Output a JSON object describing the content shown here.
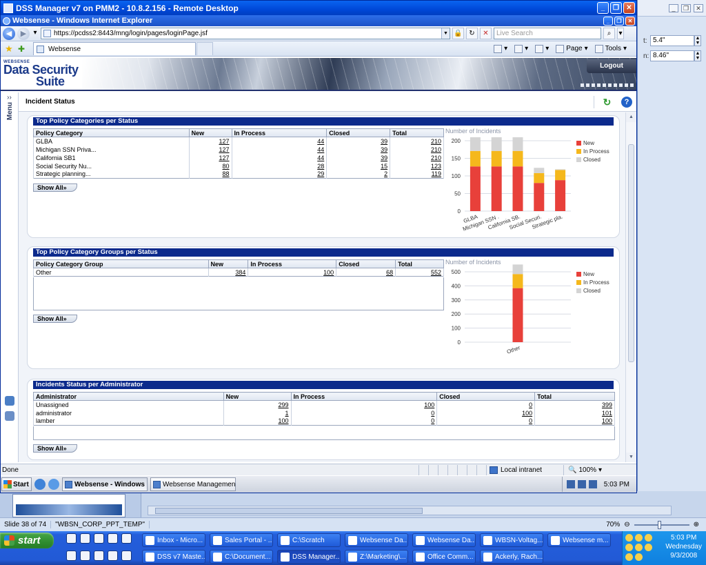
{
  "remote_desktop": {
    "title": "DSS Manager v7 on PMM2 - 10.8.2.156 - Remote Desktop"
  },
  "ie": {
    "title": "Websense - Windows Internet Explorer",
    "address": "https://pcdss2:8443/mng/login/pages/loginPage.jsf",
    "search_placeholder": "Live Search",
    "tab_label": "Websense",
    "cmd_page": "Page",
    "cmd_tools": "Tools",
    "status_done": "Done",
    "status_zone": "Local intranet",
    "status_zoom": "100%"
  },
  "websense": {
    "brand": "WEBSENSE",
    "logo_line1": "Data Security",
    "logo_line2": "Suite",
    "logout_label": "Logout",
    "menu_label": "Menu",
    "page_title": "Incident Status",
    "show_all_label": "Show All»",
    "legend": [
      "New",
      "In Process",
      "Closed"
    ],
    "chart_ylabel": "Number of Incidents"
  },
  "panel_categories": {
    "title": "Top Policy Categories per Status",
    "columns": [
      "Policy Category",
      "New",
      "In Process",
      "Closed",
      "Total"
    ],
    "rows": [
      [
        "GLBA",
        "127",
        "44",
        "39",
        "210"
      ],
      [
        "Michigan SSN Priva...",
        "127",
        "44",
        "39",
        "210"
      ],
      [
        "California SB1",
        "127",
        "44",
        "39",
        "210"
      ],
      [
        "Social Security Nu...",
        "80",
        "28",
        "15",
        "123"
      ],
      [
        "Strategic planning...",
        "88",
        "29",
        "2",
        "119"
      ]
    ]
  },
  "panel_groups": {
    "title": "Top Policy Category Groups per Status",
    "columns": [
      "Policy Category Group",
      "New",
      "In Process",
      "Closed",
      "Total"
    ],
    "rows": [
      [
        "Other",
        "384",
        "100",
        "68",
        "552"
      ]
    ]
  },
  "panel_admins": {
    "title": "Incidents Status per Administrator",
    "columns": [
      "Administrator",
      "New",
      "In Process",
      "Closed",
      "Total"
    ],
    "rows": [
      [
        "Unassigned",
        "299",
        "100",
        "0",
        "399"
      ],
      [
        "administrator",
        "1",
        "0",
        "100",
        "101"
      ],
      [
        "lamber",
        "100",
        "0",
        "0",
        "100"
      ]
    ]
  },
  "chart_data": [
    {
      "type": "bar",
      "stacked": true,
      "ylabel": "Number of Incidents",
      "ylim": [
        0,
        200
      ],
      "yticks": [
        0,
        50,
        100,
        150,
        200
      ],
      "categories": [
        "GLBA",
        "Michigan SSN .",
        "California SB.",
        "Social Securi.",
        "Strategic pla."
      ],
      "series": [
        {
          "name": "New",
          "values": [
            127,
            127,
            127,
            80,
            88
          ],
          "color": "#e8403a"
        },
        {
          "name": "In Process",
          "values": [
            44,
            44,
            44,
            28,
            29
          ],
          "color": "#f5b81c"
        },
        {
          "name": "Closed",
          "values": [
            39,
            39,
            39,
            15,
            2
          ],
          "color": "#d4d4d4"
        }
      ],
      "legend_position": "top-right",
      "grid": true
    },
    {
      "type": "bar",
      "stacked": true,
      "ylabel": "Number of Incidents",
      "ylim": [
        0,
        500
      ],
      "yticks": [
        0,
        100,
        200,
        300,
        400,
        500
      ],
      "categories": [
        "Other"
      ],
      "series": [
        {
          "name": "New",
          "values": [
            384
          ],
          "color": "#e8403a"
        },
        {
          "name": "In Process",
          "values": [
            100
          ],
          "color": "#f5b81c"
        },
        {
          "name": "Closed",
          "values": [
            68
          ],
          "color": "#d4d4d4"
        }
      ],
      "legend_position": "top-right",
      "grid": true
    }
  ],
  "rd_taskbar": {
    "start": "Start",
    "tasks": [
      "Websense - Windows ...",
      "Websense Management ..."
    ],
    "clock": "5:03 PM"
  },
  "bg_app": {
    "field1": "5.4\"",
    "field2": "8.46\"",
    "slide_status": "Slide 38 of 74",
    "template": "\"WBSN_CORP_PPT_TEMP\"",
    "zoom": "70%"
  },
  "xp_taskbar": {
    "start": "start",
    "row1": [
      "Inbox - Micro...",
      "Sales Portal - ...",
      "C:\\Scratch",
      "Websense Da...",
      "Websense Da...",
      "WBSN-Voltag...",
      "Websense m..."
    ],
    "row2": [
      "DSS v7 Maste...",
      "C:\\Document...",
      "DSS Manager...",
      "Z:\\Marketing\\...",
      "Office Comm...",
      "Ackerly, Rach..."
    ],
    "time": "5:03 PM",
    "day": "Wednesday",
    "date": "9/3/2008"
  }
}
